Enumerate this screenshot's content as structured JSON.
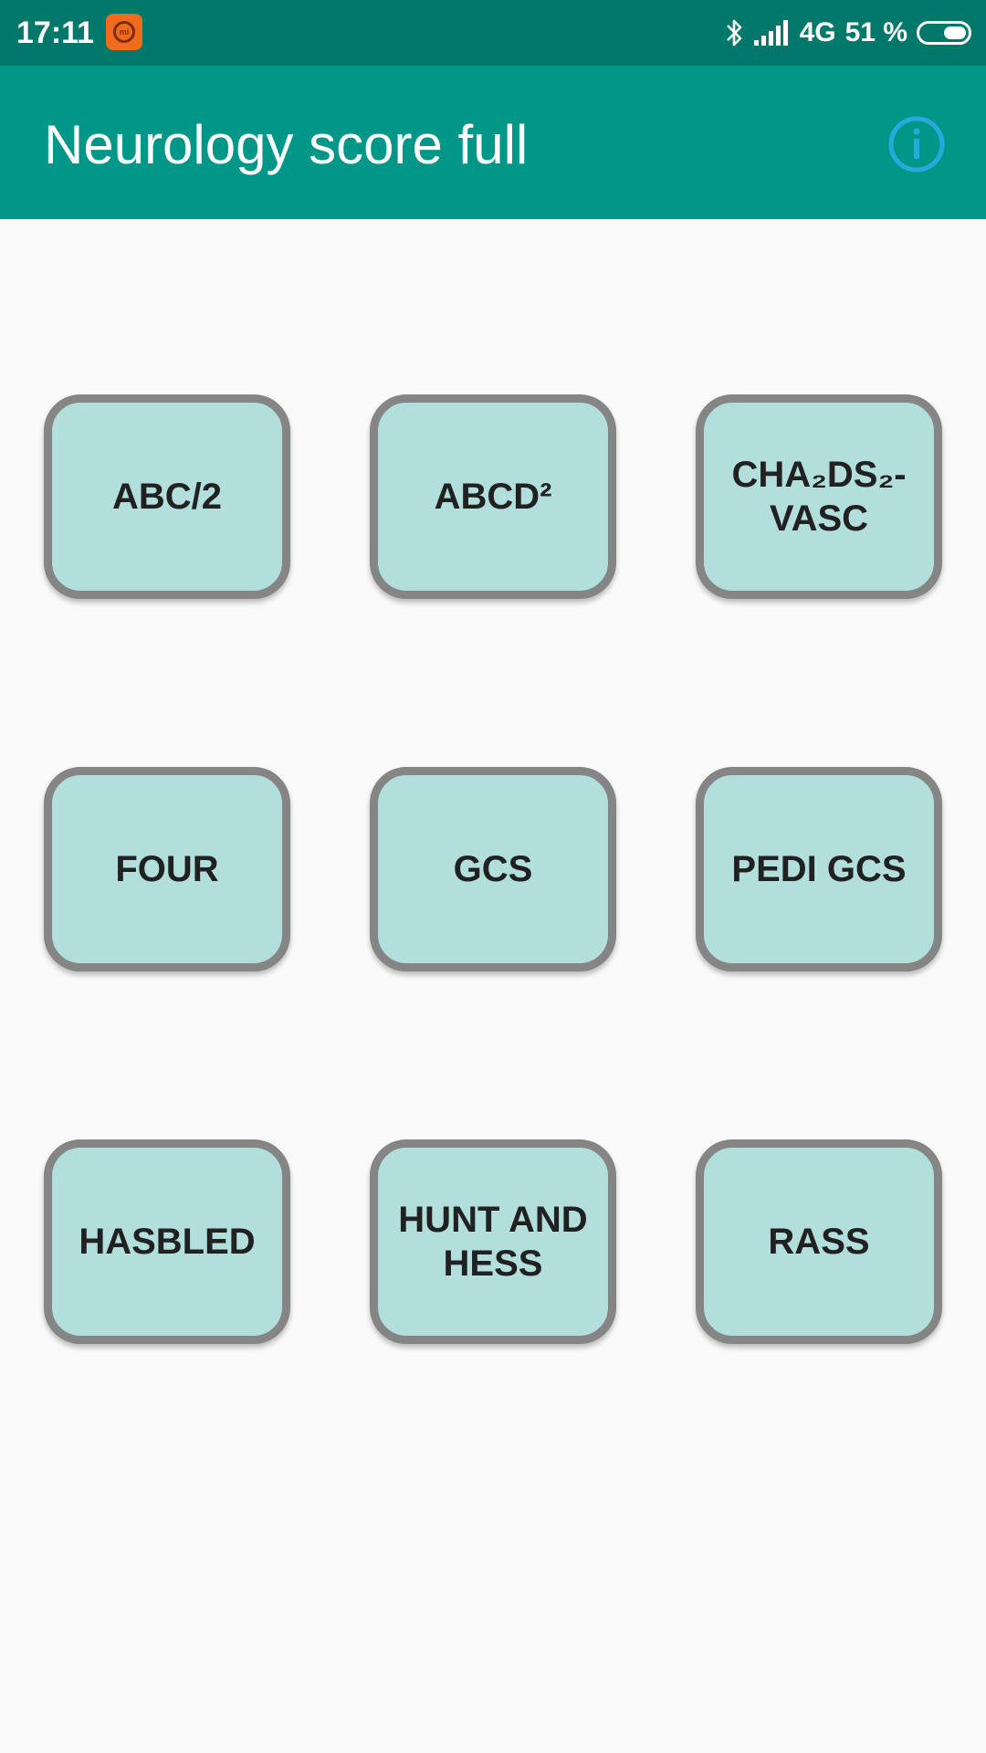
{
  "status_bar": {
    "time": "17:11",
    "network": "4G",
    "battery_percent": "51 %",
    "battery_level": 0.51,
    "icons": [
      "mi-app-icon",
      "bluetooth-icon",
      "signal-icon",
      "battery-icon"
    ]
  },
  "app_bar": {
    "title": "Neurology score full",
    "info_icon": "info-icon",
    "accent_color": "#009688",
    "info_icon_color": "#29a8dd"
  },
  "scores": [
    {
      "label": "ABC/2"
    },
    {
      "label": "ABCD²"
    },
    {
      "label": "CHA₂DS₂-VASC"
    },
    {
      "label": "FOUR"
    },
    {
      "label": "GCS"
    },
    {
      "label": "PEDI GCS"
    },
    {
      "label": "HASBLED"
    },
    {
      "label": "HUNT AND HESS"
    },
    {
      "label": "RASS"
    }
  ],
  "colors": {
    "status_bar": "#00796b",
    "button_fill": "#b2dfdb",
    "button_border": "#858585",
    "background": "#fafafa"
  }
}
